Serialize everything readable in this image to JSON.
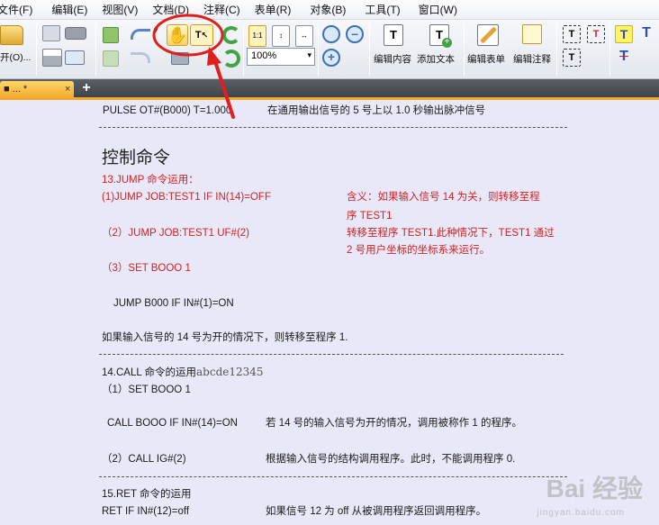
{
  "menu": [
    "文件(F)",
    "编辑(E)",
    "视图(V)",
    "文档(D)",
    "注释(C)",
    "表单(R)",
    "对象(B)",
    "工具(T)",
    "窗口(W)"
  ],
  "toolbar": {
    "open_label": "开(O)...",
    "zoom_value": "100%",
    "edit_content": "编辑内容",
    "add_text": "添加文本",
    "edit_form": "编辑表单",
    "edit_annot": "编辑注释"
  },
  "tab": {
    "title": "■ ... * ",
    "close": "×",
    "new": "+"
  },
  "doc": {
    "line_pulse_cmd": "PULSE OT#(B000) T=1.000",
    "line_pulse_desc": "在通用输出信号的 5 号上以 1.0 秒输出脉冲信号",
    "heading": "控制命令",
    "jump_title": "13.JUMP 命令运用：",
    "jump_1": "(1)JUMP JOB:TEST1 IF IN(14)=OFF",
    "jump_1_desc_a": "含义：如果输入信号 14 为关，则转移至程",
    "jump_1_desc_b": "序 TEST1",
    "jump_2": "（2）JUMP JOB:TEST1 UF#(2)",
    "jump_2_desc_a": "转移至程序 TEST1.此种情况下，TEST1 通过",
    "jump_2_desc_b": "2 号用户坐标的坐标系来运行。",
    "jump_3": "（3）SET BOOO 1",
    "jump_b000": "JUMP B000 IF IN#(1)=ON",
    "jump_b000_desc": "如果输入信号的 14 号为开的情况下，则转移至程序 1.",
    "call_title": "14.CALL 命令的运用",
    "call_title_suffix": "abcde12345",
    "call_1": "（1）SET BOOO 1",
    "call_cmd": "CALL BOOO IF IN#(14)=ON",
    "call_cmd_desc": "若 14 号的输入信号为开的情况，调用被称作 1 的程序。",
    "call_2": "（2）CALL IG#(2)",
    "call_2_desc": "根据输入信号的结构调用程序。此时，不能调用程序 0.",
    "ret_title": "15.RET 命令的运用",
    "ret_cmd": "RET IF IN#(12)=off",
    "ret_desc": "如果信号 12 为 off  从被调用程序返回调用程序。"
  },
  "watermark": {
    "main": "Bai 经验",
    "sub": "jingyan.baidu.com"
  }
}
